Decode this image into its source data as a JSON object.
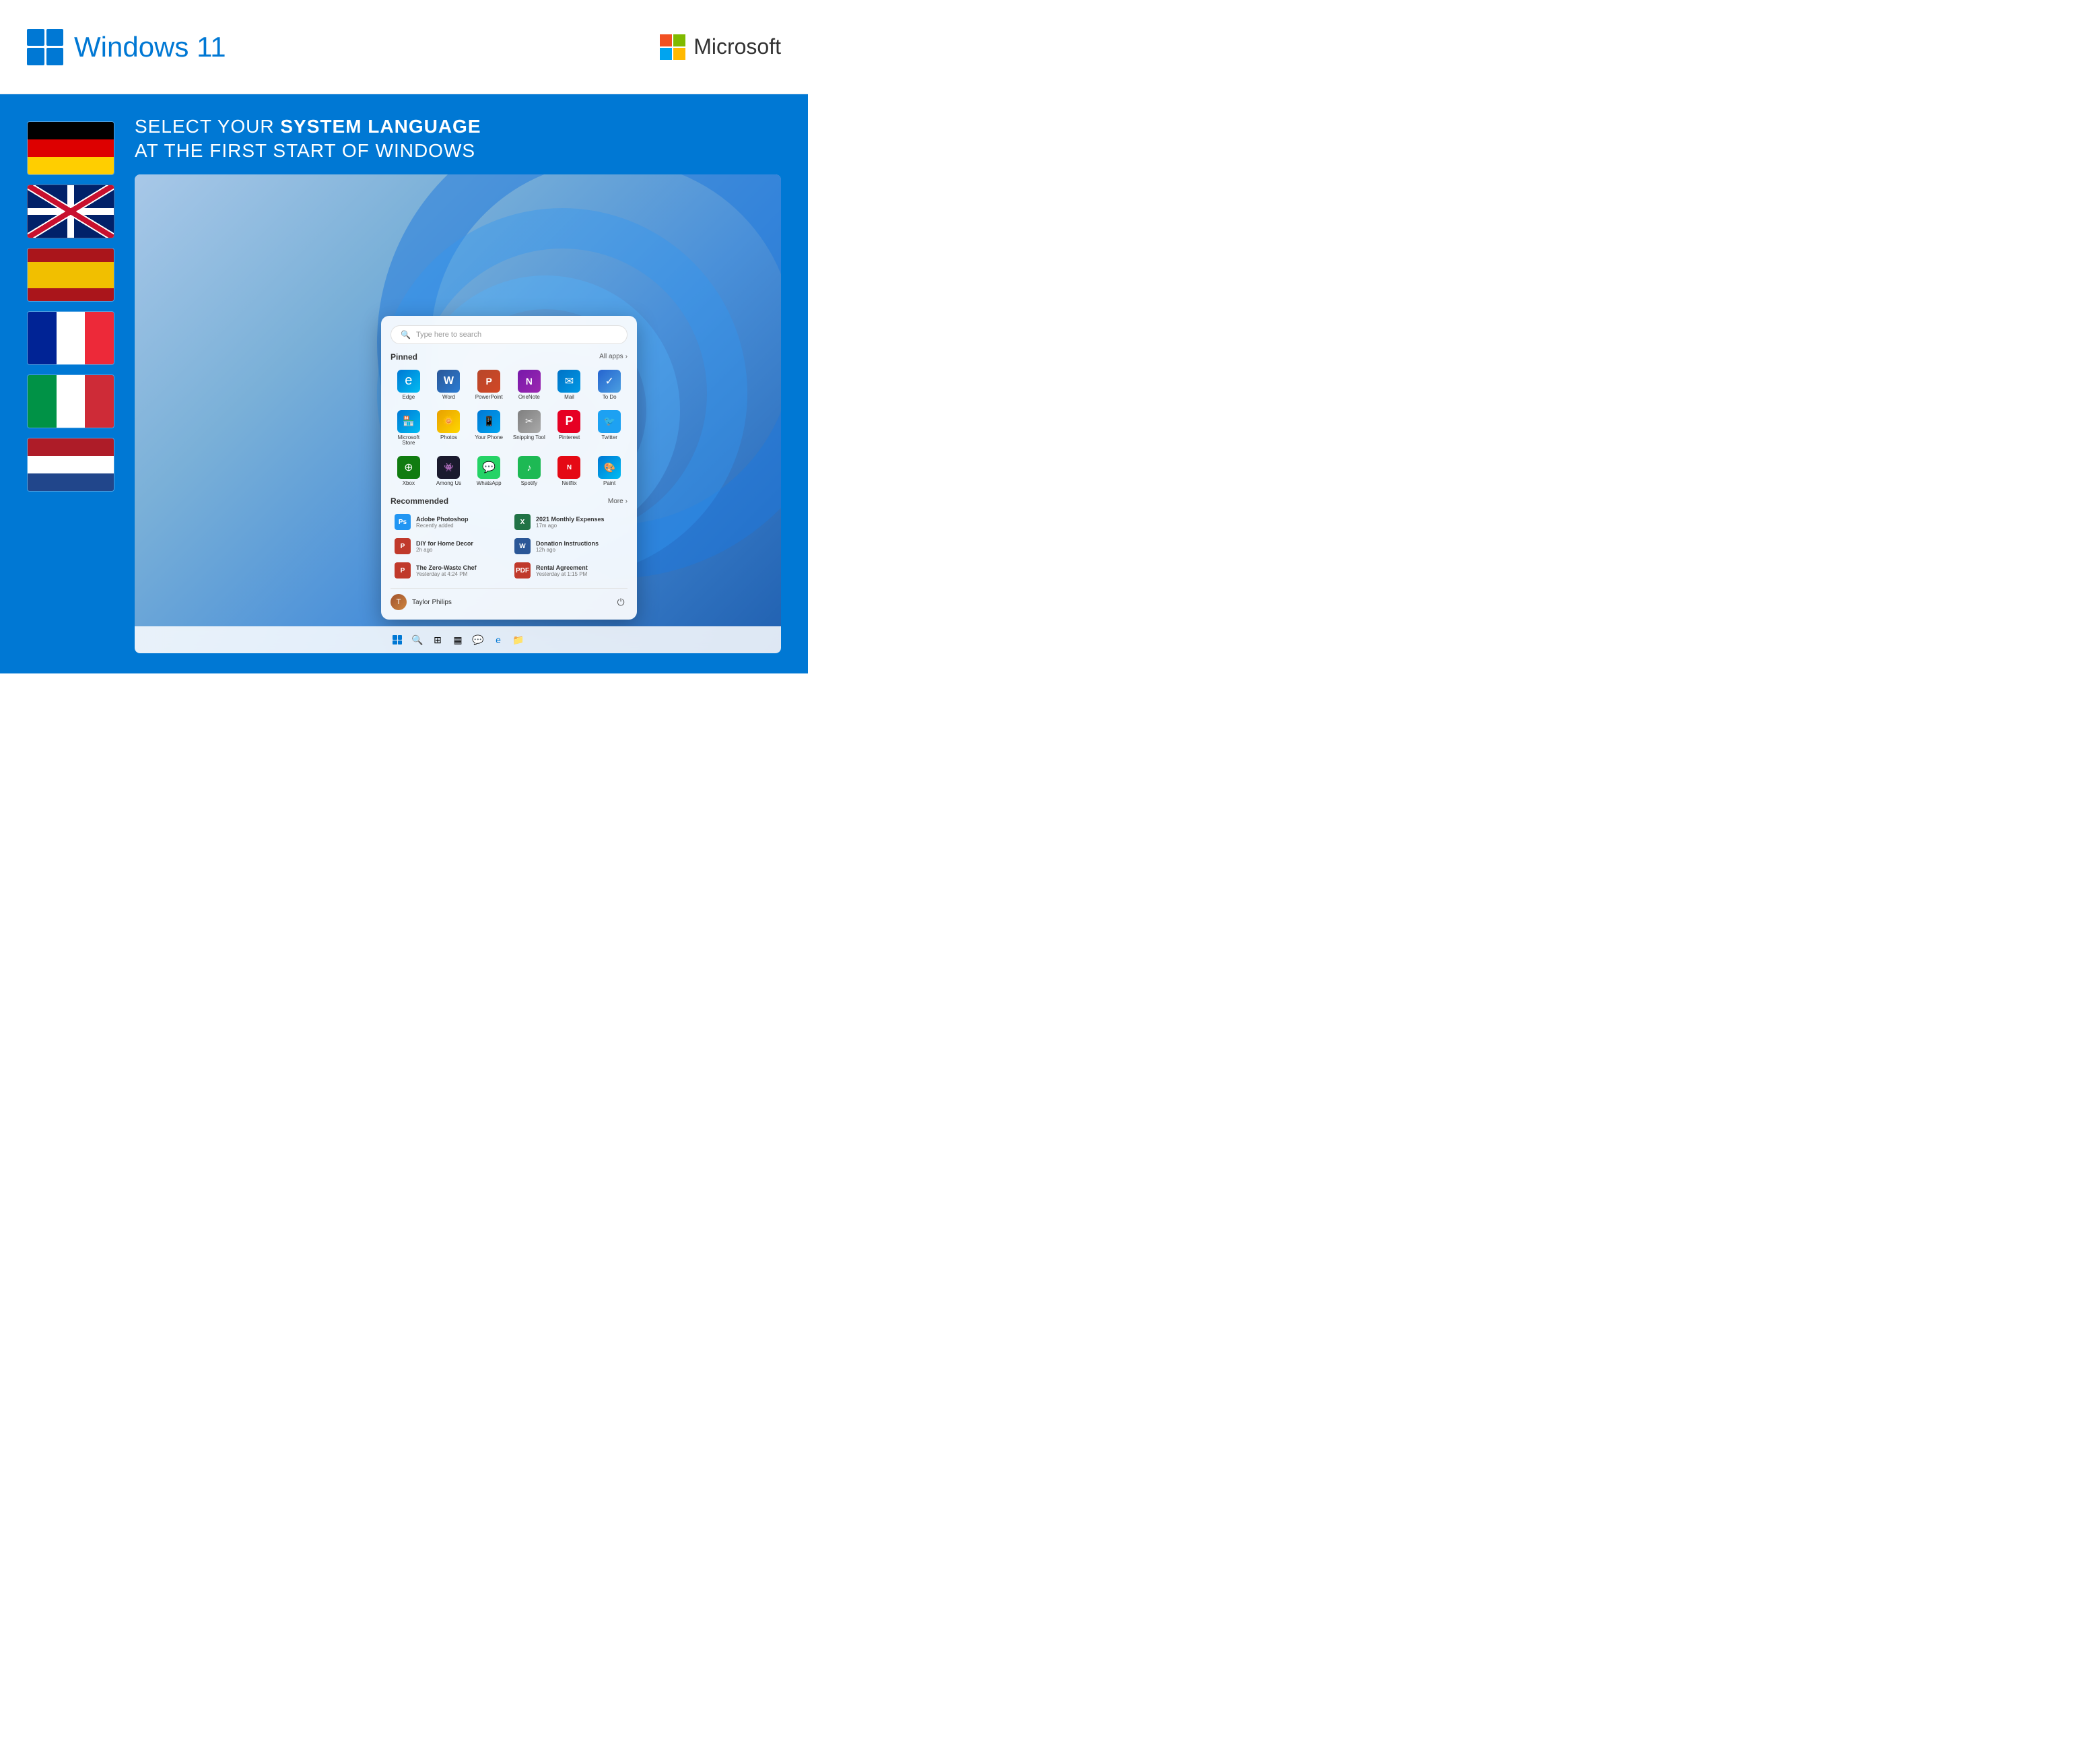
{
  "header": {
    "windows_title": "Windows 11",
    "microsoft_title": "Microsoft"
  },
  "headline": {
    "line1_regular": "SELECT YOUR ",
    "line1_bold": "SYSTEM LANGUAGE",
    "line2": "AT THE FIRST START OF WINDOWS"
  },
  "flags": [
    {
      "id": "de",
      "name": "German flag"
    },
    {
      "id": "uk",
      "name": "UK flag"
    },
    {
      "id": "es",
      "name": "Spanish flag"
    },
    {
      "id": "fr",
      "name": "French flag"
    },
    {
      "id": "it",
      "name": "Italian flag"
    },
    {
      "id": "nl",
      "name": "Netherlands flag"
    }
  ],
  "start_menu": {
    "search_placeholder": "Type here to search",
    "pinned_label": "Pinned",
    "all_apps_label": "All apps",
    "recommended_label": "Recommended",
    "more_label": "More",
    "apps": [
      {
        "id": "edge",
        "label": "Edge"
      },
      {
        "id": "word",
        "label": "Word"
      },
      {
        "id": "powerpoint",
        "label": "PowerPoint"
      },
      {
        "id": "onenote",
        "label": "OneNote"
      },
      {
        "id": "mail",
        "label": "Mail"
      },
      {
        "id": "todo",
        "label": "To Do"
      },
      {
        "id": "store",
        "label": "Microsoft Store"
      },
      {
        "id": "photos",
        "label": "Photos"
      },
      {
        "id": "yourphone",
        "label": "Your Phone"
      },
      {
        "id": "snipping",
        "label": "Snipping Tool"
      },
      {
        "id": "pinterest",
        "label": "Pinterest"
      },
      {
        "id": "twitter",
        "label": "Twitter"
      },
      {
        "id": "xbox",
        "label": "Xbox"
      },
      {
        "id": "amongus",
        "label": "Among Us"
      },
      {
        "id": "whatsapp",
        "label": "WhatsApp"
      },
      {
        "id": "spotify",
        "label": "Spotify"
      },
      {
        "id": "netflix",
        "label": "Netflix"
      },
      {
        "id": "paint",
        "label": "Paint"
      }
    ],
    "recommended": [
      {
        "id": "photoshop",
        "name": "Adobe Photoshop",
        "time": "Recently added",
        "color": "#2196f3"
      },
      {
        "id": "expenses",
        "name": "2021 Monthly Expenses",
        "time": "17m ago",
        "color": "#217346"
      },
      {
        "id": "diyhome",
        "name": "DIY for Home Decor",
        "time": "2h ago",
        "color": "#c0392b"
      },
      {
        "id": "donation",
        "name": "Donation Instructions",
        "time": "12h ago",
        "color": "#2b5797"
      },
      {
        "id": "zerowaste",
        "name": "The Zero-Waste Chef",
        "time": "Yesterday at 4:24 PM",
        "color": "#c0392b"
      },
      {
        "id": "rental",
        "name": "Rental Agreement",
        "time": "Yesterday at 1:15 PM",
        "color": "#c0392b"
      }
    ],
    "user": {
      "name": "Taylor Philips",
      "avatar_letter": "T"
    }
  }
}
